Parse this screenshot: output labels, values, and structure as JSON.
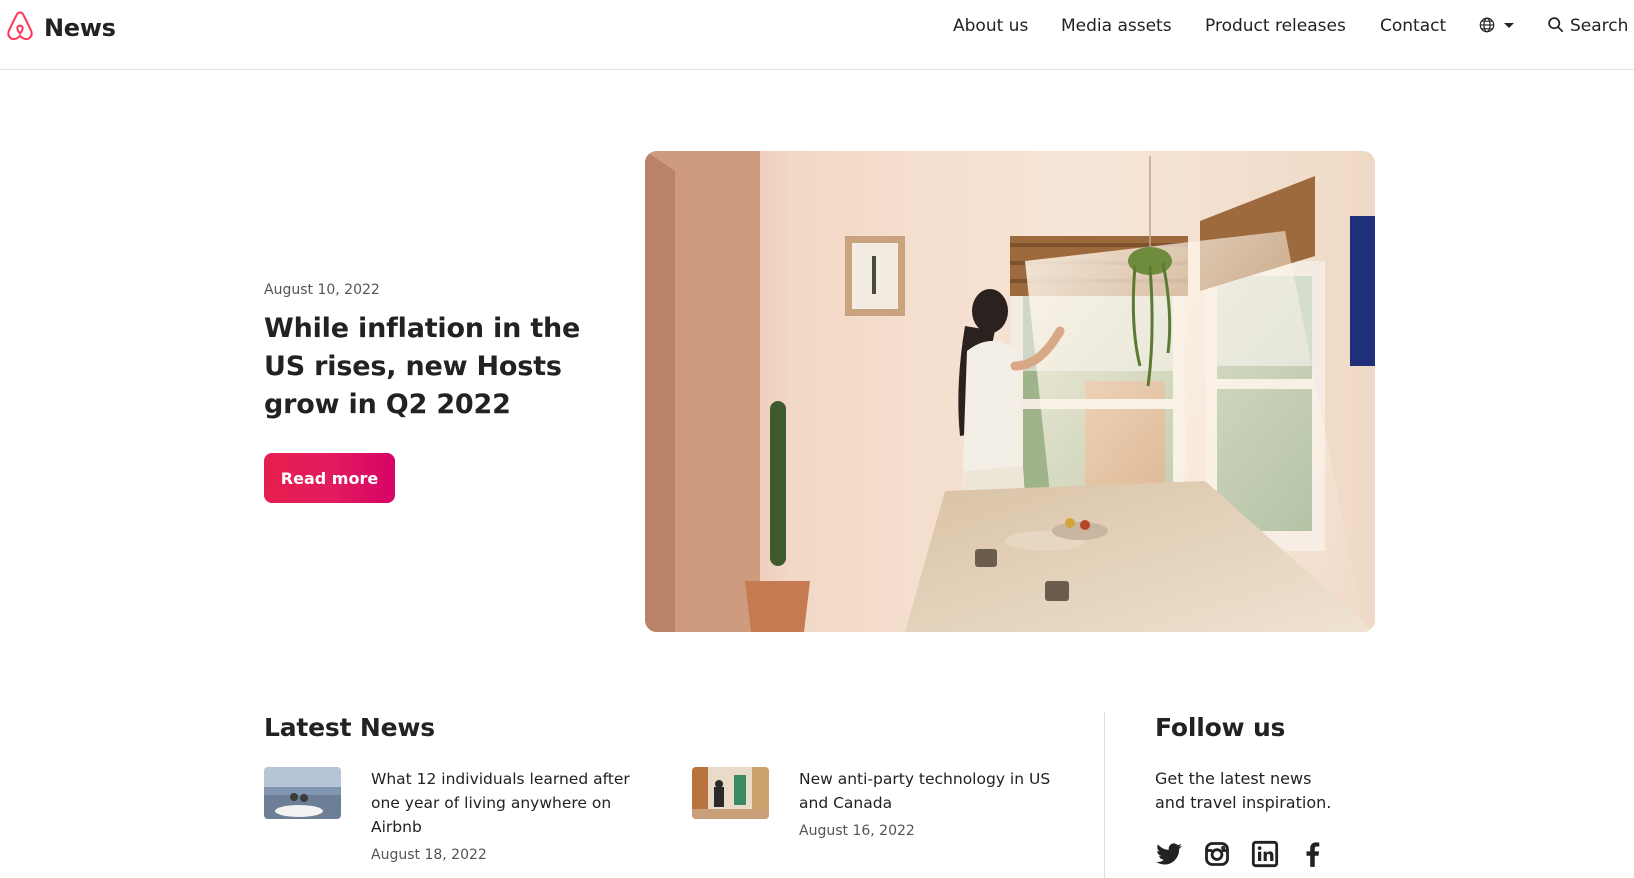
{
  "header": {
    "brand": "News",
    "nav": [
      "About us",
      "Media assets",
      "Product releases",
      "Contact"
    ],
    "search_label": "Search"
  },
  "hero": {
    "date": "August 10, 2022",
    "title": "While inflation in the US rises, new Hosts grow in Q2 2022",
    "read_more": "Read more"
  },
  "latest": {
    "heading": "Latest News",
    "items": [
      {
        "title": "What 12 individuals learned after one year of living anywhere on Airbnb",
        "date": "August 18, 2022"
      },
      {
        "title": "New anti-party technology in US and Canada",
        "date": "August 16, 2022"
      }
    ]
  },
  "follow": {
    "heading": "Follow us",
    "text": "Get the latest news and travel inspiration.",
    "icons": [
      "twitter-icon",
      "instagram-icon",
      "linkedin-icon",
      "facebook-icon"
    ]
  },
  "colors": {
    "brand": "#ff385c",
    "button_start": "#e61e4d",
    "button_end": "#d70466"
  }
}
